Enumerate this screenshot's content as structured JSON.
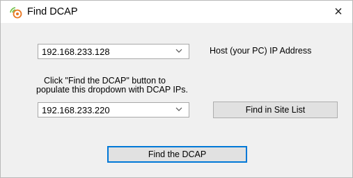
{
  "window": {
    "title": "Find DCAP",
    "close_glyph": "×"
  },
  "host_ip": {
    "value": "192.168.233.128",
    "label": "Host (your PC) IP Address"
  },
  "instructions": {
    "line1": "Click \"Find the DCAP\" button to",
    "line2": "populate this dropdown with DCAP IPs."
  },
  "dcap_ip": {
    "value": "192.168.233.220"
  },
  "buttons": {
    "find_in_site_list": "Find in Site List",
    "find_the_dcap": "Find the DCAP"
  },
  "icons": {
    "app": "signal-app-icon",
    "chevron": "chevron-down-icon",
    "close": "close-icon"
  },
  "colors": {
    "accent": "#0078d7",
    "icon_orange": "#e87722",
    "icon_green": "#6fbf44"
  }
}
